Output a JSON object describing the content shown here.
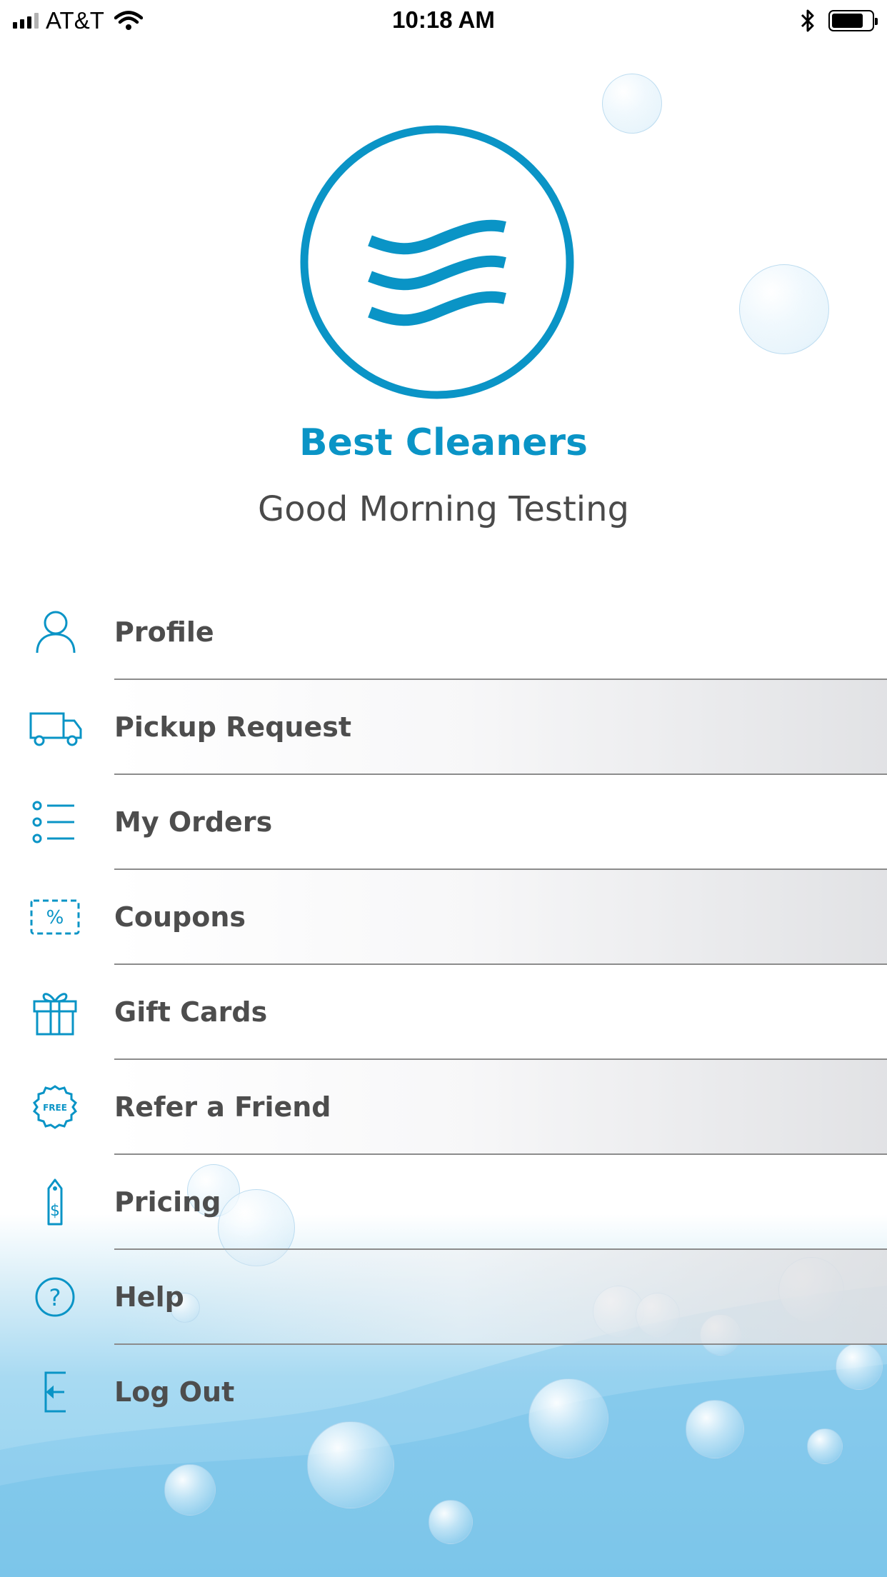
{
  "status_bar": {
    "carrier": "AT&T",
    "time": "10:18 AM",
    "battery_level": 0.8,
    "signal_bars": 3
  },
  "brand": {
    "name": "Best Cleaners",
    "greeting": "Good Morning Testing",
    "accent_color": "#0a94c6"
  },
  "menu": [
    {
      "label": "Profile",
      "icon": "person-icon"
    },
    {
      "label": "Pickup Request",
      "icon": "truck-icon"
    },
    {
      "label": "My Orders",
      "icon": "list-icon"
    },
    {
      "label": "Coupons",
      "icon": "coupon-icon"
    },
    {
      "label": "Gift Cards",
      "icon": "gift-icon"
    },
    {
      "label": "Refer a Friend",
      "icon": "free-badge-icon"
    },
    {
      "label": "Pricing",
      "icon": "price-tag-icon"
    },
    {
      "label": "Help",
      "icon": "help-icon"
    },
    {
      "label": "Log Out",
      "icon": "logout-icon"
    }
  ],
  "free_badge_text": "FREE"
}
